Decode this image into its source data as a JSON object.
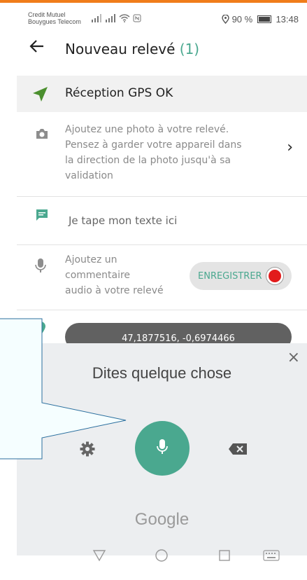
{
  "status": {
    "carrier_line1": "Credit Mutuel",
    "carrier_line2": "Bouygues Telecom",
    "battery_percent": "90 %",
    "battery_level": 0.9,
    "time": "13:48"
  },
  "appbar": {
    "title": "Nouveau relevé",
    "count": "(1)"
  },
  "gps": {
    "label": "Réception GPS OK"
  },
  "photo": {
    "line1": "Ajoutez une photo à votre relevé.",
    "line2": "Pensez à garder votre appareil dans",
    "line3": "la direction de la photo jusqu'à sa",
    "line4": "validation",
    "chevron": "›"
  },
  "text_note": {
    "placeholder": "Je tape mon texte ici"
  },
  "audio": {
    "line1": "Ajoutez un",
    "line2": "commentaire",
    "line3": "audio à votre relevé",
    "record_label": "ENREGISTRER"
  },
  "coords": {
    "value": "47,1877516, -0,6974466"
  },
  "voice": {
    "title": "Dites quelque chose",
    "close": "×",
    "brand": "Google"
  },
  "colors": {
    "accent": "#4aa88f",
    "record": "#e21b1b",
    "top_line": "#f07d1a"
  }
}
